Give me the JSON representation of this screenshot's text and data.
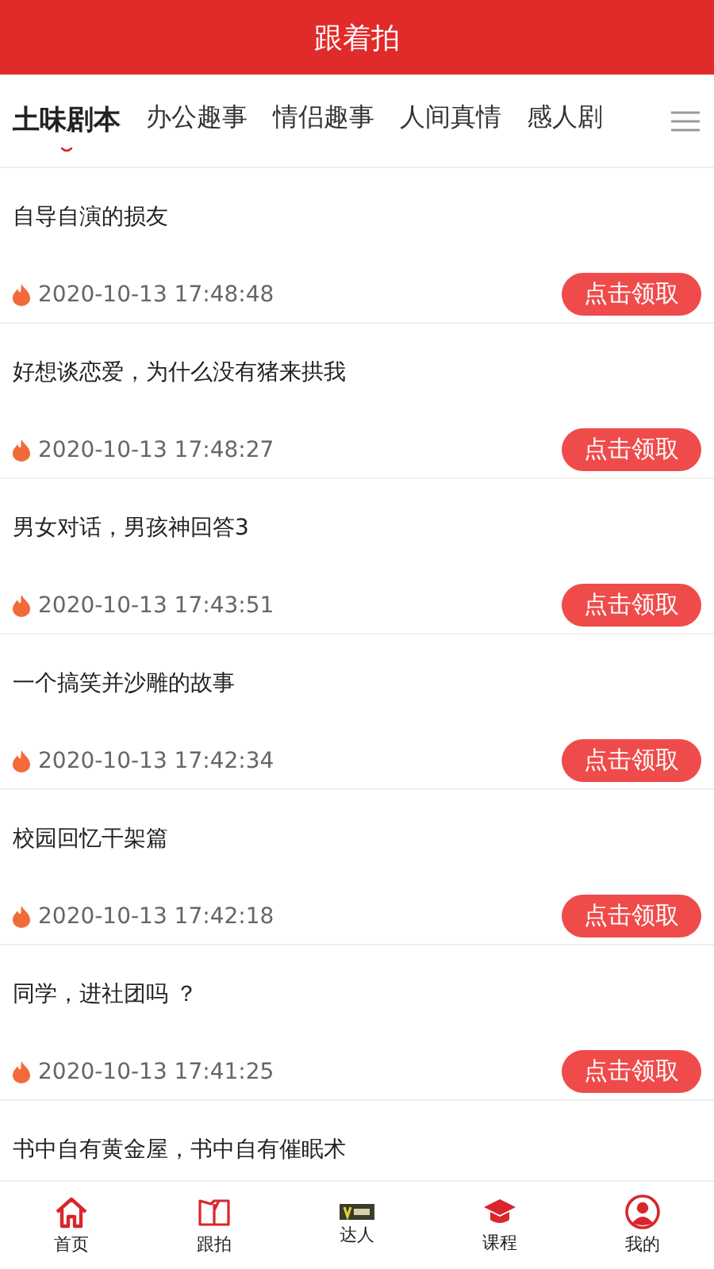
{
  "header": {
    "title": "跟着拍"
  },
  "tabs": [
    {
      "label": "土味剧本",
      "selected": true
    },
    {
      "label": "办公趣事",
      "selected": false
    },
    {
      "label": "情侣趣事",
      "selected": false
    },
    {
      "label": "人间真情",
      "selected": false
    },
    {
      "label": "感人剧",
      "selected": false
    }
  ],
  "items": [
    {
      "title": "自导自演的损友",
      "time": "2020-10-13 17:48:48",
      "button": "点击领取"
    },
    {
      "title": "好想谈恋爱，为什么没有猪来拱我",
      "time": "2020-10-13 17:48:27",
      "button": "点击领取"
    },
    {
      "title": "男女对话，男孩神回答3",
      "time": "2020-10-13 17:43:51",
      "button": "点击领取"
    },
    {
      "title": "一个搞笑并沙雕的故事",
      "time": "2020-10-13 17:42:34",
      "button": "点击领取"
    },
    {
      "title": "校园回忆干架篇",
      "time": "2020-10-13 17:42:18",
      "button": "点击领取"
    },
    {
      "title": "同学，进社团吗 ？",
      "time": "2020-10-13 17:41:25",
      "button": "点击领取"
    },
    {
      "title": "书中自有黄金屋，书中自有催眠术"
    }
  ],
  "nav": [
    {
      "kind": "home",
      "label": "首页"
    },
    {
      "kind": "book",
      "label": "跟拍"
    },
    {
      "kind": "badge",
      "label": "达人"
    },
    {
      "kind": "cap",
      "label": "课程"
    },
    {
      "kind": "user",
      "label": "我的"
    }
  ]
}
